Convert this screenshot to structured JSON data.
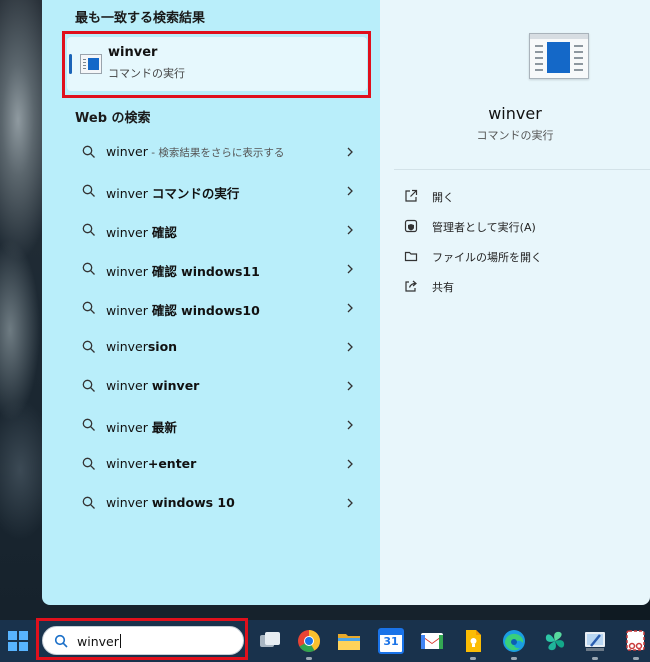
{
  "best_match": {
    "section_title": "最も一致する検索結果",
    "name": "winver",
    "type": "コマンドの実行",
    "icon": "winver-app-icon"
  },
  "web_search": {
    "section_title": "Web の検索",
    "items": [
      {
        "query": "winver",
        "bold": "",
        "hint": " - 検索結果をさらに表示する"
      },
      {
        "query": "winver ",
        "bold": "コマンドの実行",
        "hint": ""
      },
      {
        "query": "winver ",
        "bold": "確認",
        "hint": ""
      },
      {
        "query": "winver ",
        "bold": "確認 windows11",
        "hint": ""
      },
      {
        "query": "winver ",
        "bold": "確認 windows10",
        "hint": ""
      },
      {
        "query": "winver",
        "bold": "sion",
        "hint": ""
      },
      {
        "query": "winver ",
        "bold": "winver",
        "hint": ""
      },
      {
        "query": "winver ",
        "bold": "最新",
        "hint": ""
      },
      {
        "query": "winver",
        "bold": "+enter",
        "hint": ""
      },
      {
        "query": "winver ",
        "bold": "windows 10",
        "hint": ""
      }
    ]
  },
  "details": {
    "app_name": "winver",
    "app_type": "コマンドの実行",
    "actions": [
      {
        "label": "開く",
        "icon": "open-icon"
      },
      {
        "label": "管理者として実行(A)",
        "icon": "shield-icon"
      },
      {
        "label": "ファイルの場所を開く",
        "icon": "folder-icon"
      },
      {
        "label": "共有",
        "icon": "share-icon"
      }
    ]
  },
  "taskbar": {
    "search_value": "winver",
    "apps": [
      {
        "name": "task-view-icon"
      },
      {
        "name": "chrome-icon"
      },
      {
        "name": "file-explorer-icon"
      },
      {
        "name": "calendar-icon",
        "label": "31"
      },
      {
        "name": "gmail-icon"
      },
      {
        "name": "keep-icon"
      },
      {
        "name": "edge-icon"
      },
      {
        "name": "photos-icon"
      },
      {
        "name": "paint-icon"
      },
      {
        "name": "snipping-tool-icon"
      }
    ]
  },
  "colors": {
    "highlight": "#e0101c",
    "left_pane": "#b9eefa",
    "right_pane": "#e8f6fb",
    "taskbar": "#19324c"
  }
}
